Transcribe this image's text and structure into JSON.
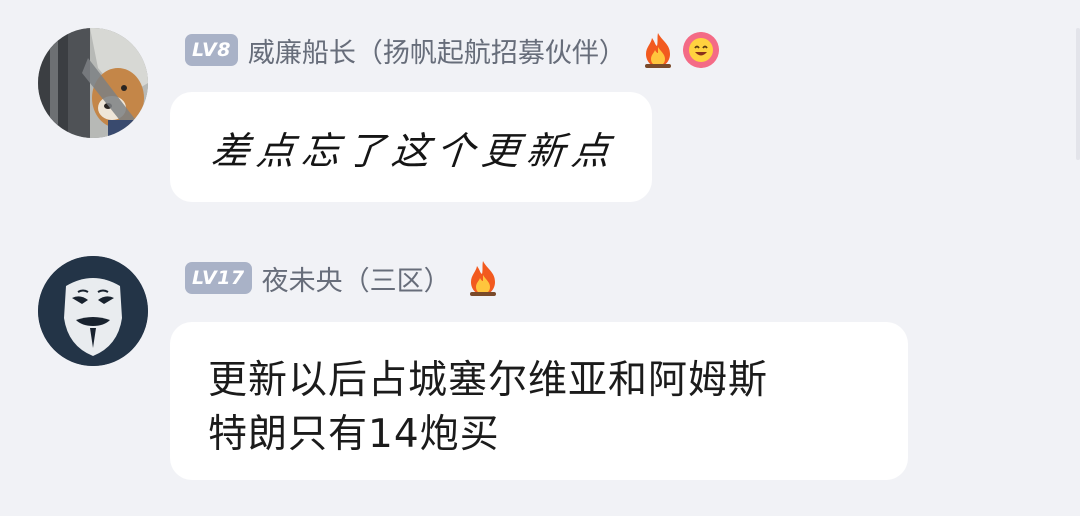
{
  "messages": [
    {
      "level": "LV8",
      "username": "威廉船长（扬帆起航招募伙伴）",
      "badges": [
        "fire-icon",
        "smiling-face-badge-icon"
      ],
      "text": "差点忘了这个更新点"
    },
    {
      "level": "LV17",
      "username": "夜未央（三区）",
      "badges": [
        "fire-icon"
      ],
      "text_lines": [
        "更新以后占城塞尔维亚和阿姆斯",
        "特朗只有14炮买"
      ]
    }
  ],
  "colors": {
    "background": "#f1f2f6",
    "bubble": "#ffffff",
    "level_badge": "#a9b2c7",
    "username": "#676d7a",
    "message_text": "#1b1b1b"
  }
}
